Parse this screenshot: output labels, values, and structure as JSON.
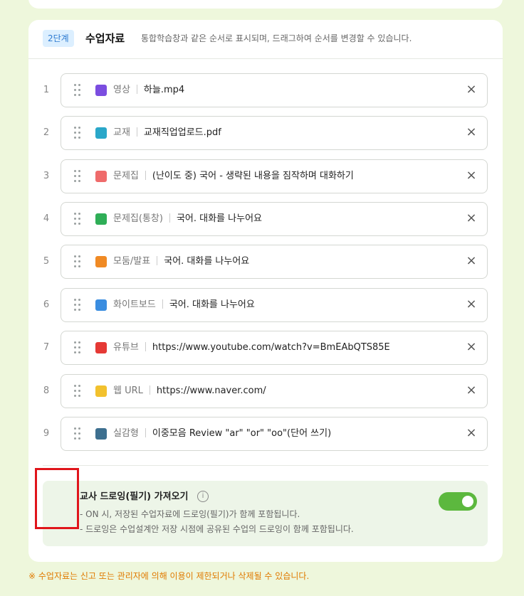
{
  "header": {
    "step_badge": "2단계",
    "title": "수업자료",
    "description": "통합학습창과 같은 순서로 표시되며, 드래그하여 순서를 변경할 수 있습니다."
  },
  "items": [
    {
      "num": "1",
      "type": "영상",
      "value": "하늘.mp4",
      "icon": "video-icon",
      "color": "#7b4de0"
    },
    {
      "num": "2",
      "type": "교재",
      "value": "교재직업업로드.pdf",
      "icon": "textbook-icon",
      "color": "#2aa7c9"
    },
    {
      "num": "3",
      "type": "문제집",
      "value": "(난이도 중) 국어 - 생략된 내용을 짐작하며 대화하기",
      "icon": "workbook-icon",
      "color": "#ef6b6b"
    },
    {
      "num": "4",
      "type": "문제집(통창)",
      "value": "국어. 대화를 나누어요",
      "icon": "workbook-integrated-icon",
      "color": "#2fae57"
    },
    {
      "num": "5",
      "type": "모둠/발표",
      "value": "국어. 대화를 나누어요",
      "icon": "group-presentation-icon",
      "color": "#f08a24"
    },
    {
      "num": "6",
      "type": "화이트보드",
      "value": "국어. 대화를 나누어요",
      "icon": "whiteboard-icon",
      "color": "#3a8de0"
    },
    {
      "num": "7",
      "type": "유튜브",
      "value": "https://www.youtube.com/watch?v=BmEAbQTS85E",
      "icon": "youtube-icon",
      "color": "#e53935"
    },
    {
      "num": "8",
      "type": "웹 URL",
      "value": "https://www.naver.com/",
      "icon": "web-url-icon",
      "color": "#f2c12e"
    },
    {
      "num": "9",
      "type": "실감형",
      "value": "이중모음 Review \"ar\" \"or\" \"oo\"(단어 쓰기)",
      "icon": "immersive-icon",
      "color": "#3d6f8f"
    }
  ],
  "option": {
    "title": "교사 드로잉(필기) 가져오기",
    "line1": "- ON 시, 저장된 수업자료에 드로잉(필기)가 함께 포함됩니다.",
    "line2": "- 드로잉은 수업설계안 저장 시점에 공유된 수업의 드로잉이 함께 포함됩니다.",
    "toggle_on": true
  },
  "footer": {
    "note": "※ 수업자료는 신고 또는 관리자에 의해 이용이 제한되거나 삭제될 수 있습니다."
  },
  "colors": {
    "background": "#eef7dc",
    "toggle_on": "#5cb83e",
    "footer_text": "#e07a00",
    "highlight": "#e0151b"
  }
}
